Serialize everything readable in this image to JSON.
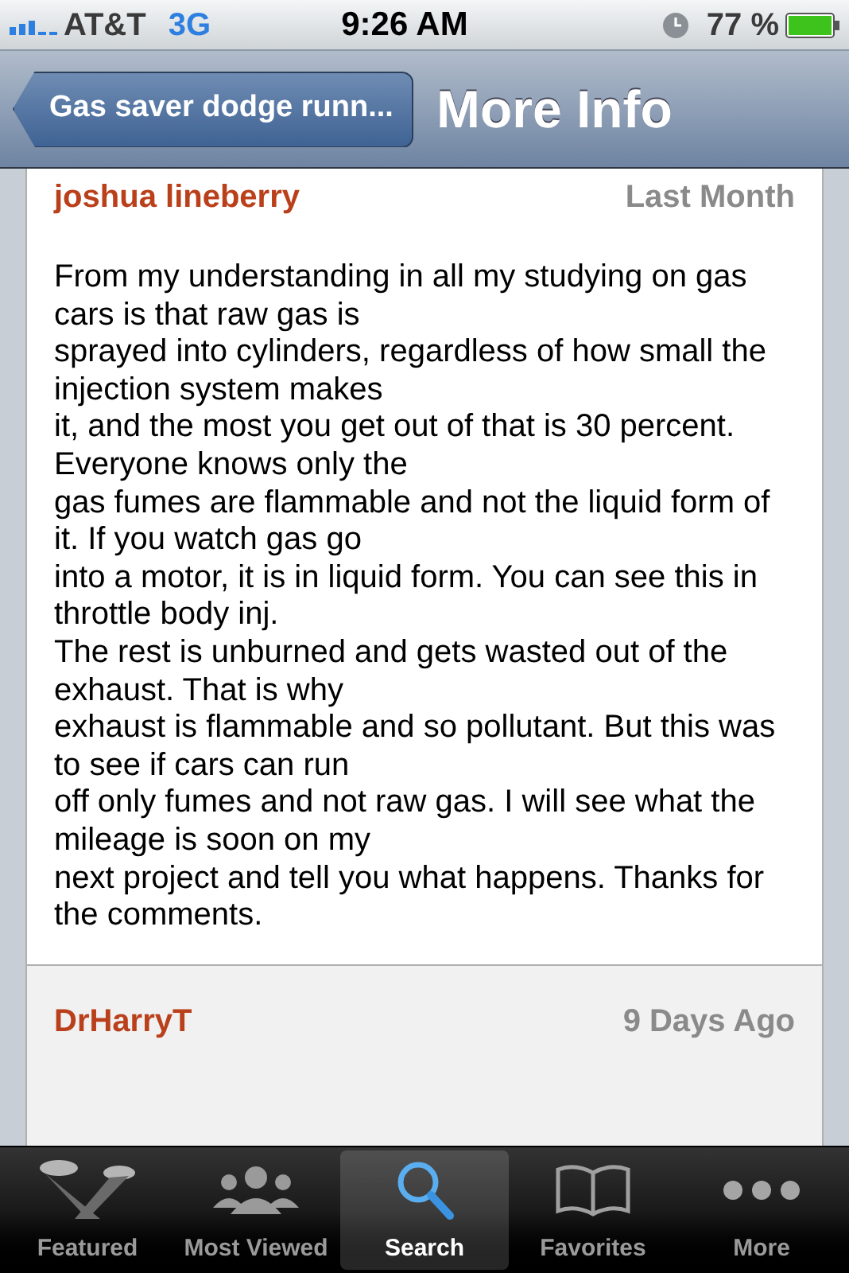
{
  "status_bar": {
    "carrier": "AT&T",
    "network": "3G",
    "time": "9:26 AM",
    "battery": "77 %"
  },
  "nav_bar": {
    "back": "Gas saver dodge runn...",
    "title": "More Info"
  },
  "comments": [
    {
      "author": "joshua lineberry",
      "date": "Last Month",
      "body": "From my understanding in all my studying on gas cars is that  raw gas is\nsprayed into cylinders, regardless of how small the injection system makes\nit, and the most you get out of that is 30 percent. Everyone knows only the\ngas fumes are flammable and not the liquid form of it. If you watch gas go\ninto a motor, it is in liquid form. You can see this in throttle body inj.\nThe rest is unburned and gets wasted out of the exhaust. That is why\nexhaust is flammable and so pollutant. But this was to see if cars can run\noff only fumes and not raw gas. I will see what the mileage is soon on my\nnext project and tell you what happens. Thanks for the comments."
    },
    {
      "author": "DrHarryT",
      "date": "9 Days Ago"
    }
  ],
  "tab_bar": [
    {
      "label": "Featured",
      "selected": false
    },
    {
      "label": "Most Viewed",
      "selected": false
    },
    {
      "label": "Search",
      "selected": true
    },
    {
      "label": "Favorites",
      "selected": false
    },
    {
      "label": "More",
      "selected": false
    }
  ]
}
